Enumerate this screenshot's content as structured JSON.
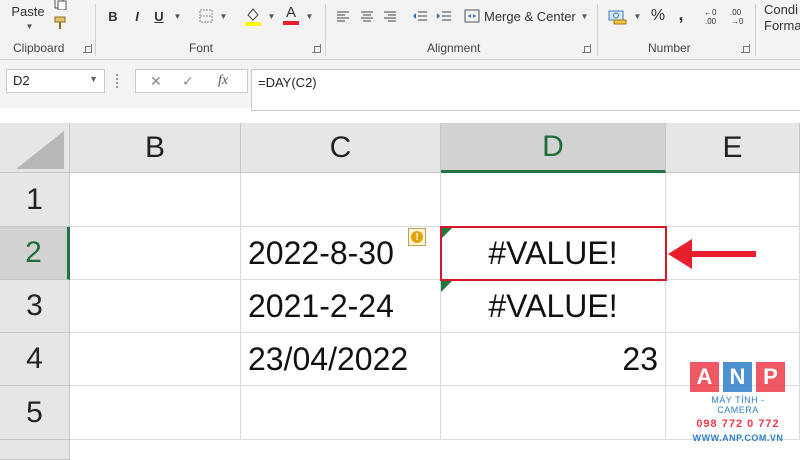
{
  "ribbon": {
    "paste_label": "Paste",
    "clipboard_label": "Clipboard",
    "font_label": "Font",
    "alignment_label": "Alignment",
    "number_label": "Number",
    "merge_center_label": "Merge & Center",
    "bold": "B",
    "italic": "I",
    "underline": "U",
    "font_color_glyph": "A",
    "percent": "%",
    "comma": ",",
    "cond_format_line1": "Condi",
    "cond_format_line2": "Format"
  },
  "formula_bar": {
    "name_box": "D2",
    "cancel_glyph": "✕",
    "enter_glyph": "✓",
    "fx_glyph": "fx",
    "formula": "=DAY(C2)"
  },
  "grid": {
    "columns": [
      "B",
      "C",
      "D",
      "E"
    ],
    "selected_column": "D",
    "rows": [
      "1",
      "2",
      "3",
      "4",
      "5"
    ],
    "selected_row": "2",
    "cells": {
      "C2": "2022-8-30",
      "C3": "2021-2-24",
      "C4": "23/04/2022",
      "D2": "#VALUE!",
      "D3": "#VALUE!",
      "D4": "23"
    },
    "warning_glyph": "!"
  },
  "colors": {
    "accent_green": "#217346",
    "highlight_red": "#d6182a",
    "arrow_red": "#e8202e"
  },
  "watermark": {
    "letters": [
      "A",
      "N",
      "P"
    ],
    "tagline": "MÁY TÍNH - CAMERA",
    "phone": "098 772 0 772",
    "site": "WWW.ANP.COM.VN"
  }
}
